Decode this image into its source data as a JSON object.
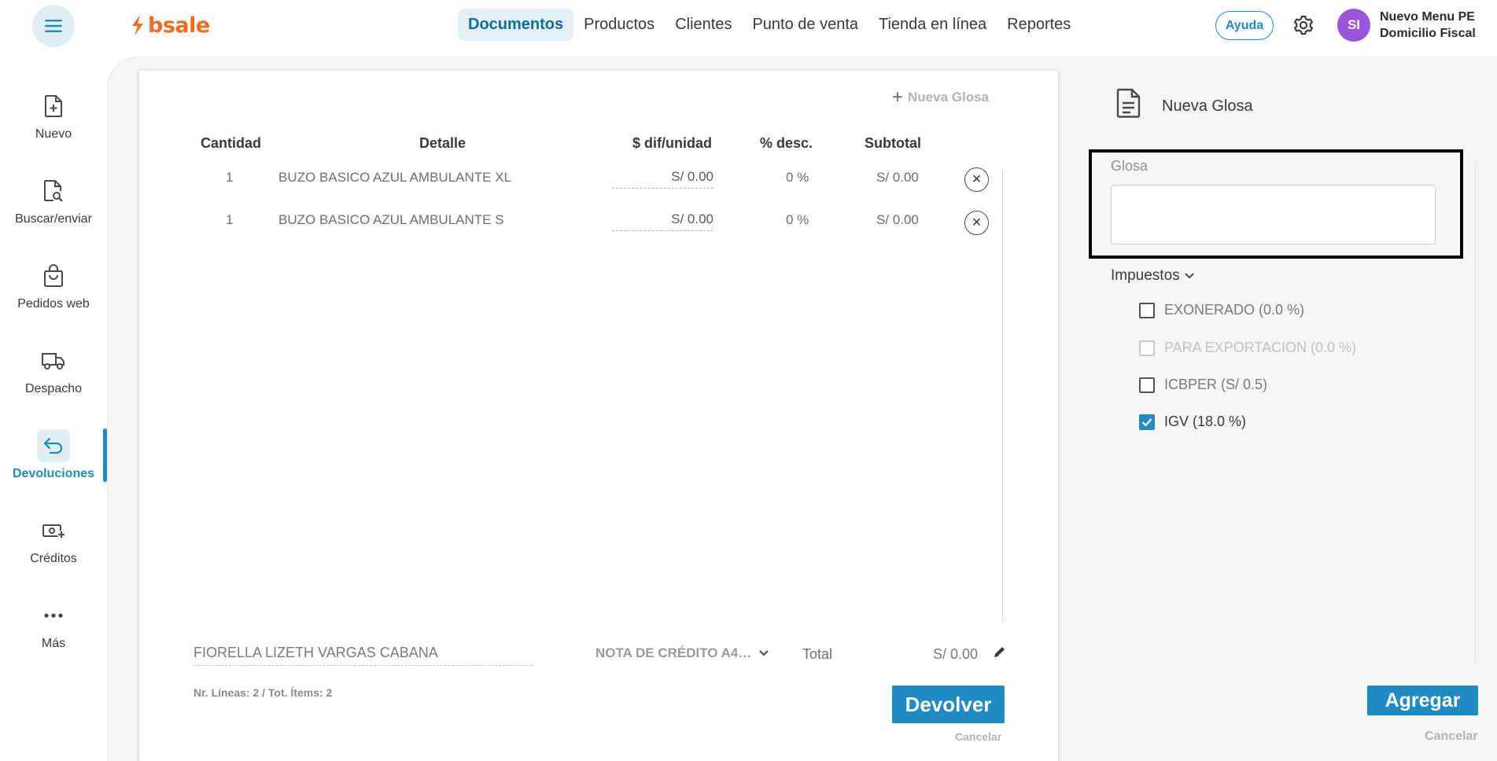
{
  "header": {
    "logo_text": "bsale",
    "nav": [
      {
        "label": "Documentos",
        "active": true
      },
      {
        "label": "Productos",
        "active": false
      },
      {
        "label": "Clientes",
        "active": false
      },
      {
        "label": "Punto de venta",
        "active": false
      },
      {
        "label": "Tienda en línea",
        "active": false
      },
      {
        "label": "Reportes",
        "active": false
      }
    ],
    "help_label": "Ayuda",
    "avatar_initials": "SI",
    "company_line1": "Nuevo Menu PE",
    "company_line2": "Domicilio Fiscal"
  },
  "sidebar": {
    "items": [
      {
        "label": "Nuevo",
        "icon": "file-plus-icon"
      },
      {
        "label": "Buscar/enviar",
        "icon": "file-search-icon"
      },
      {
        "label": "Pedidos web",
        "icon": "shopping-bag-icon"
      },
      {
        "label": "Despacho",
        "icon": "truck-icon"
      },
      {
        "label": "Devoluciones",
        "icon": "return-arrow-icon",
        "active": true
      },
      {
        "label": "Créditos",
        "icon": "money-plus-icon"
      },
      {
        "label": "Más",
        "icon": "more-dots-icon"
      }
    ]
  },
  "document": {
    "new_glosa_link": "Nueva Glosa",
    "columns": {
      "qty": "Cantidad",
      "detail": "Detalle",
      "unit_diff": "$ dif/unidad",
      "discount": "% desc.",
      "subtotal": "Subtotal"
    },
    "rows": [
      {
        "qty": "1",
        "detail": "BUZO BASICO AZUL AMBULANTE XL",
        "unit_diff": "S/ 0.00",
        "discount": "0 %",
        "subtotal": "S/ 0.00"
      },
      {
        "qty": "1",
        "detail": "BUZO BASICO AZUL AMBULANTE S",
        "unit_diff": "S/ 0.00",
        "discount": "0 %",
        "subtotal": "S/ 0.00"
      }
    ],
    "client_name": "FIORELLA LIZETH VARGAS CABANA",
    "doc_type": "NOTA DE CRÉDITO A4…",
    "total_label": "Total",
    "total_value": "S/ 0.00",
    "counts": "Nr. Líneas: 2 / Tot. Ítems: 2",
    "submit_label": "Devolver",
    "cancel_label": "Cancelar"
  },
  "panel": {
    "title": "Nueva Glosa",
    "glosa_label": "Glosa",
    "glosa_value": "",
    "taxes_label": "Impuestos",
    "taxes": [
      {
        "label": "EXONERADO (0.0 %)",
        "checked": false,
        "disabled": false
      },
      {
        "label": "PARA EXPORTACION (0.0 %)",
        "checked": false,
        "disabled": true
      },
      {
        "label": "ICBPER (S/ 0.5)",
        "checked": false,
        "disabled": false
      },
      {
        "label": "IGV (18.0 %)",
        "checked": true,
        "disabled": false
      }
    ],
    "add_label": "Agregar",
    "cancel_label": "Cancelar"
  },
  "colors": {
    "accent": "#1e8bc3",
    "brand": "#f26b21",
    "avatar": "#9b55d8"
  }
}
